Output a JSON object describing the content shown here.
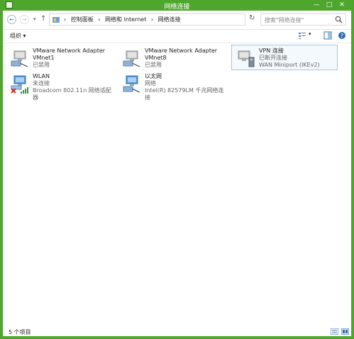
{
  "window": {
    "title": "网络连接"
  },
  "address": {
    "crumbs": [
      "控制面板",
      "网络和 Internet",
      "网络连接"
    ],
    "search_placeholder": "搜索\"网络连接\""
  },
  "toolbar": {
    "organize_label": "组织 ▾"
  },
  "items": [
    {
      "name": "VMware Network Adapter",
      "line2": "VMnet1",
      "line3": "已禁用",
      "icon": "network-adapter-disabled-icon"
    },
    {
      "name": "VMware Network Adapter",
      "line2": "VMnet8",
      "line3": "已禁用",
      "icon": "network-adapter-disabled-icon"
    },
    {
      "name": "VPN 连接",
      "line2": "已断开连接",
      "line3": "WAN Miniport (IKEv2)",
      "icon": "vpn-connection-icon"
    },
    {
      "name": "WLAN",
      "line2": "未连接",
      "line3": "Broadcom 802.11n 网络适配器",
      "icon": "wlan-icon"
    },
    {
      "name": "以太网",
      "line2": "网络",
      "line3": "Intel(R) 82579LM 千兆网络连接",
      "icon": "ethernet-icon"
    }
  ],
  "status": {
    "count": "5 个项目"
  },
  "colors": {
    "titlebar": "#4ea72c",
    "selection_border": "#99c9ef"
  }
}
